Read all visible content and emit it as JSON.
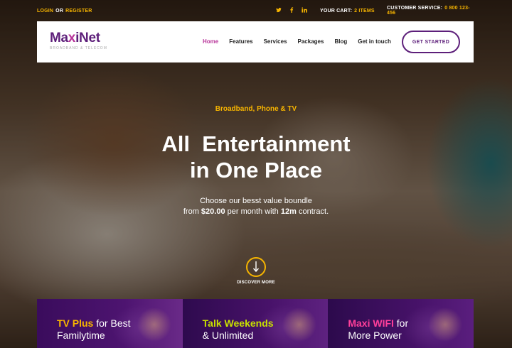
{
  "topbar": {
    "login": "LOGIN",
    "or": "OR",
    "register": "REGISTER",
    "social": [
      "twitter-icon",
      "facebook-icon",
      "linkedin-icon"
    ],
    "cart_label": "YOUR CART:",
    "cart_value": "2 ITEMS",
    "service_label": "CUSTOMER SERVICE:",
    "service_value": "0 800 123-456"
  },
  "brand": {
    "name_prefix": "Ma",
    "name_x": "x",
    "name_suffix": "iNet",
    "tagline": "BROADBAND & TELECOM",
    "accent": "#b8359a",
    "primary": "#5d1f7a",
    "highlight": "#f7b500"
  },
  "nav": {
    "items": [
      "Home",
      "Features",
      "Services",
      "Packages",
      "Blog",
      "Get in touch"
    ],
    "active": "Home",
    "cta": "GET STARTED"
  },
  "hero": {
    "eyebrow": "Broadband, Phone & TV",
    "headline_line1": "All  Entertainment",
    "headline_line2": "in One Place",
    "sub_line1": "Choose our besst value boundle",
    "sub_from": "from",
    "sub_price": "$20.00",
    "sub_mid": "per month with",
    "sub_term": "12m",
    "sub_end": "contract.",
    "discover": "DISCOVER MORE"
  },
  "cards": [
    {
      "highlight": "TV Plus",
      "rest1": " for Best",
      "line2": "Familytime"
    },
    {
      "highlight": "Talk Weekends",
      "rest1": "",
      "line2": "& Unlimited"
    },
    {
      "highlight": "Maxi WIFI",
      "rest1": " for",
      "line2": "More Power"
    }
  ]
}
